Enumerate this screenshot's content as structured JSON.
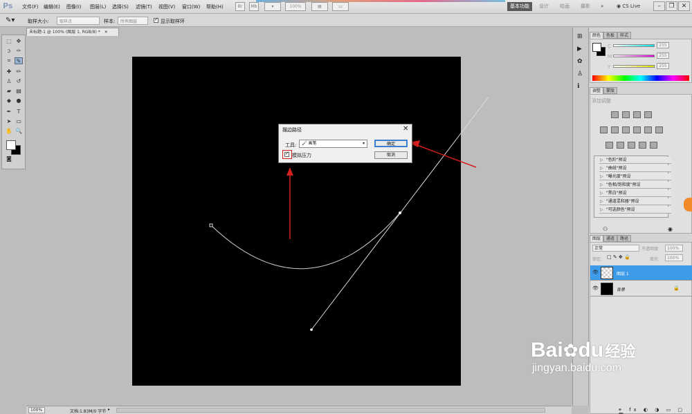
{
  "app": {
    "logo": "Ps"
  },
  "menu": [
    "文件(F)",
    "编辑(E)",
    "图像(I)",
    "图层(L)",
    "选择(S)",
    "滤镜(T)",
    "视图(V)",
    "窗口(W)",
    "帮助(H)"
  ],
  "toolbar_top": {
    "br_label": "Br",
    "mb_label": "Mb",
    "zoom": "100%"
  },
  "workspace": {
    "active": "基本功能",
    "items": [
      "设计",
      "绘画",
      "摄影"
    ],
    "more": "»",
    "cslive": "CS Live"
  },
  "window_buttons": {
    "minimize": "–",
    "restore": "❐",
    "close": "✕"
  },
  "options": {
    "sample_size_label": "取样大小:",
    "sample_size_value": "取样点",
    "sample_label": "样本:",
    "sample_value": "所有图层",
    "show_ring_label": "显示取样环"
  },
  "document": {
    "tab_title": "未标题-1 @ 100% (图层 1, RGB/8) *",
    "tab_close": "✕"
  },
  "status": {
    "zoom": "100%",
    "doc_info": "文档:1.83M/0 字节"
  },
  "dialog": {
    "title": "描边路径",
    "close": "✕",
    "tool_label": "工具:",
    "tool_value": "画笔",
    "simulate_pressure_label": "模拟压力",
    "simulate_pressure_checked": true,
    "ok_label": "确定",
    "cancel_label": "取消"
  },
  "color_panel": {
    "tabs": [
      "颜色",
      "色板",
      "样式"
    ],
    "channels": [
      {
        "label": "C",
        "value": "255",
        "color": "#00e5e5"
      },
      {
        "label": "M",
        "value": "255",
        "color": "#e500e5"
      },
      {
        "label": "Y",
        "value": "255",
        "color": "#e5e500"
      }
    ]
  },
  "adjust_panel": {
    "tabs": [
      "调整",
      "蒙版"
    ],
    "hint": "添加调整",
    "presets": [
      "\"色阶\"预设",
      "\"曲线\"预设",
      "\"曝光度\"预设",
      "\"色相/饱和度\"预设",
      "\"黑白\"预设",
      "\"通道混和器\"预设",
      "\"可选颜色\"预设"
    ]
  },
  "layers_panel": {
    "tabs": [
      "图层",
      "通道",
      "路径"
    ],
    "blend_mode": "正常",
    "opacity_label": "不透明度:",
    "opacity_value": "100%",
    "lock_label": "锁定:",
    "fill_label": "填充:",
    "fill_value": "100%",
    "layers": [
      {
        "name": "图层 1",
        "selected": true
      },
      {
        "name": "背景",
        "selected": false
      }
    ]
  },
  "watermark": {
    "brand": "Bai",
    "brand2": "du",
    "cn": "经验",
    "url": "jingyan.baidu.com"
  },
  "colors": {
    "accent_red": "#d21f1f",
    "selected_layer": "#3d9be9",
    "canvas_bg": "#000000",
    "ok_border": "#3a7fd0"
  }
}
